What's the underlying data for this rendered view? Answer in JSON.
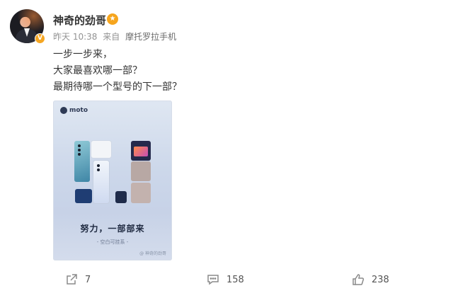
{
  "post": {
    "username": "神奇的劲哥",
    "time": "昨天 10:38",
    "source_prefix": "来自",
    "source": "摩托罗拉手机",
    "lines": [
      "一步一步来，",
      "大家最喜欢哪一部？",
      "最期待哪一个型号的下一部？"
    ]
  },
  "poster": {
    "brand": "moto",
    "slogan": "努力，一部部来",
    "subslogan": "- 空白可挂系 -",
    "watermark": "@ 神奇的劲哥"
  },
  "actions": {
    "share_count": "7",
    "comment_count": "158",
    "like_count": "238"
  },
  "icons": {
    "verified": "verified-badge-icon",
    "fan_badge": "fan-badge-icon",
    "share": "share-icon",
    "comment": "comment-icon",
    "like": "thumbs-up-icon"
  },
  "colors": {
    "badge": "#f5a623",
    "meta_text": "#939393"
  }
}
